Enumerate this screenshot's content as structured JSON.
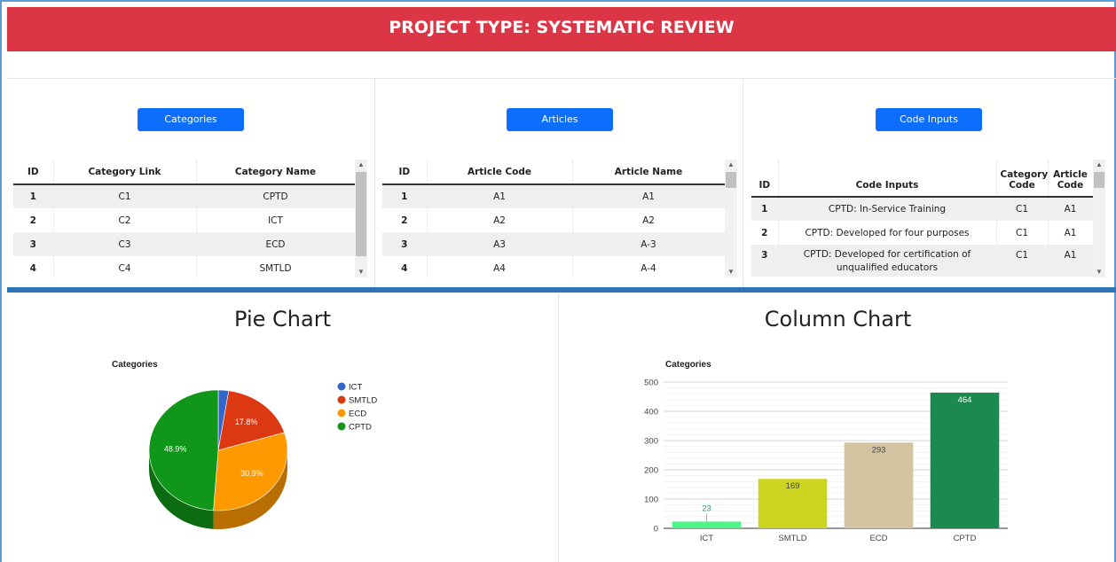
{
  "header": {
    "title": "PROJECT TYPE: SYSTEMATIC REVIEW"
  },
  "categories_panel": {
    "button_label": "Categories",
    "columns": [
      "ID",
      "Category Link",
      "Category Name"
    ],
    "rows": [
      [
        "1",
        "C1",
        "CPTD"
      ],
      [
        "2",
        "C2",
        "ICT"
      ],
      [
        "3",
        "C3",
        "ECD"
      ],
      [
        "4",
        "C4",
        "SMTLD"
      ]
    ]
  },
  "articles_panel": {
    "button_label": "Articles",
    "columns": [
      "ID",
      "Article Code",
      "Article Name"
    ],
    "rows": [
      [
        "1",
        "A1",
        "A1"
      ],
      [
        "2",
        "A2",
        "A2"
      ],
      [
        "3",
        "A3",
        "A-3"
      ],
      [
        "4",
        "A4",
        "A-4"
      ]
    ]
  },
  "code_inputs_panel": {
    "button_label": "Code Inputs",
    "columns": [
      "ID",
      "Code Inputs",
      "Category Code",
      "Article Code"
    ],
    "rows": [
      [
        "1",
        "CPTD: In-Service Training",
        "C1",
        "A1"
      ],
      [
        "2",
        "CPTD: Developed for four purposes",
        "C1",
        "A1"
      ],
      [
        "3",
        "CPTD: Developed for certification of unqualified educators",
        "C1",
        "A1"
      ]
    ]
  },
  "pie_section": {
    "heading": "Pie Chart"
  },
  "column_section": {
    "heading": "Column Chart"
  },
  "colors": {
    "banner": "#dc3545",
    "button": "#0d6efd",
    "divider": "#2f75b5"
  },
  "chart_data": [
    {
      "type": "pie",
      "title": "Categories",
      "legend_position": "right",
      "slices": [
        {
          "label": "ICT",
          "value": 23,
          "percent_label": "",
          "color": "#3366cc"
        },
        {
          "label": "SMTLD",
          "value": 169,
          "percent_label": "17.8%",
          "color": "#dc3912"
        },
        {
          "label": "ECD",
          "value": 293,
          "percent_label": "30.9%",
          "color": "#ff9900"
        },
        {
          "label": "CPTD",
          "value": 464,
          "percent_label": "48.9%",
          "color": "#109618"
        }
      ]
    },
    {
      "type": "bar",
      "title": "Categories",
      "categories": [
        "ICT",
        "SMTLD",
        "ECD",
        "CPTD"
      ],
      "values": [
        23,
        169,
        293,
        464
      ],
      "colors": [
        "#4cf58a",
        "#cdd520",
        "#d5c4a1",
        "#1b8a51"
      ],
      "ylim": [
        0,
        500
      ],
      "yticks": [
        0,
        100,
        200,
        300,
        400,
        500
      ],
      "grid": true
    }
  ]
}
